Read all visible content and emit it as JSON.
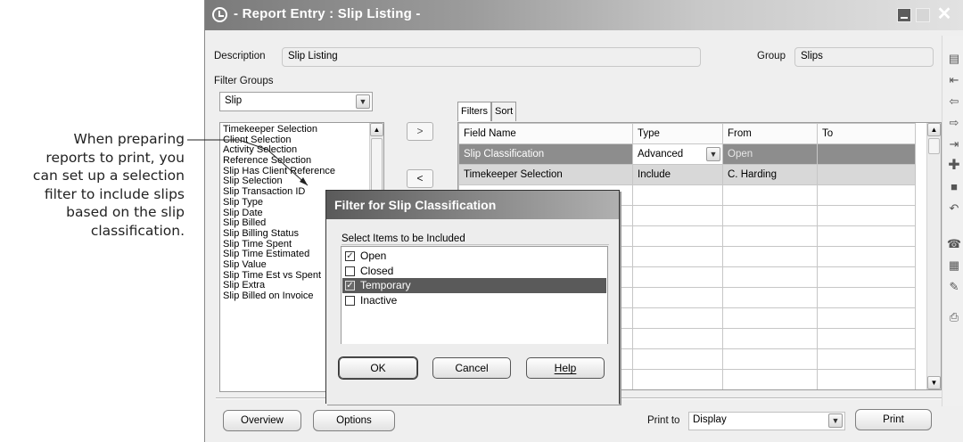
{
  "callout": {
    "lines": [
      "When preparing",
      "reports to print, you",
      "can set up a selection",
      "filter to include slips",
      "based on the slip",
      "classification."
    ]
  },
  "window": {
    "title": "- Report Entry : Slip Listing -"
  },
  "form": {
    "description_label": "Description",
    "description_value": "Slip Listing",
    "group_label": "Group",
    "group_value": "Slips",
    "filter_groups_label": "Filter Groups",
    "filter_groups_value": "Slip"
  },
  "field_list": [
    "Timekeeper Selection",
    "Client Selection",
    "Activity Selection",
    "Reference Selection",
    "Slip Has Client Reference",
    "Slip Selection",
    "Slip Transaction ID",
    "Slip Type",
    "Slip Date",
    "Slip Billed",
    "Slip Billing Status",
    "Slip Time Spent",
    "Slip Time Estimated",
    "Slip Value",
    "Slip Time Est vs Spent",
    "Slip Extra",
    "Slip Billed on Invoice"
  ],
  "move_buttons": {
    "add": ">",
    "remove": "<"
  },
  "tabs": [
    "Filters",
    "Sort"
  ],
  "grid": {
    "headers": [
      "Field Name",
      "Type",
      "From",
      "To"
    ],
    "rows": [
      {
        "field": "Slip Classification",
        "type": "Advanced",
        "from": "Open",
        "to": ""
      },
      {
        "field": "Timekeeper Selection",
        "type": "Include",
        "from": "C. Harding",
        "to": ""
      }
    ]
  },
  "dialog": {
    "title": "Filter for Slip Classification",
    "list_label": "Select Items to be Included",
    "items": [
      {
        "label": "Open",
        "checked": true
      },
      {
        "label": "Closed",
        "checked": false
      },
      {
        "label": "Temporary",
        "checked": true
      },
      {
        "label": "Inactive",
        "checked": false
      }
    ],
    "ok": "OK",
    "cancel": "Cancel",
    "help": "Help"
  },
  "footer": {
    "overview": "Overview",
    "options": "Options",
    "print_to_label": "Print to",
    "print_to_value": "Display",
    "print": "Print"
  },
  "toolbar_icons": [
    "notes-icon",
    "first-record-icon",
    "previous-record-icon",
    "next-record-icon",
    "last-record-icon",
    "add-record-icon",
    "save-icon",
    "undo-icon",
    "phone-icon",
    "calculator-icon",
    "spelling-icon",
    "print-icon"
  ]
}
